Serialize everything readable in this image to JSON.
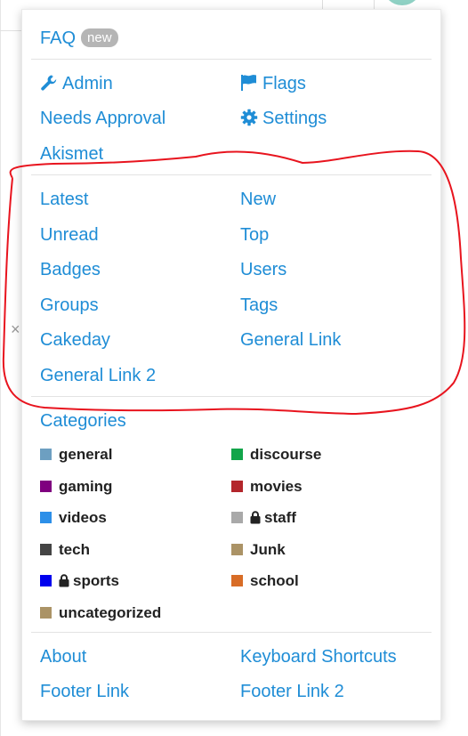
{
  "menu": {
    "faq_label": "FAQ",
    "faq_badge": "new",
    "admin": {
      "admin": "Admin",
      "flags": "Flags",
      "needs_approval": "Needs Approval",
      "settings": "Settings",
      "akismet": "Akismet"
    },
    "nav": {
      "latest": "Latest",
      "new": "New",
      "unread": "Unread",
      "top": "Top",
      "badges": "Badges",
      "users": "Users",
      "groups": "Groups",
      "tags": "Tags",
      "cakeday": "Cakeday",
      "general_link": "General Link",
      "general_link_2": "General Link 2"
    },
    "categories_label": "Categories",
    "categories": [
      {
        "name": "general",
        "color": "#6d9fc1",
        "locked": false
      },
      {
        "name": "discourse",
        "color": "#12a54a",
        "locked": false
      },
      {
        "name": "gaming",
        "color": "#7f007f",
        "locked": false
      },
      {
        "name": "movies",
        "color": "#b3262b",
        "locked": false
      },
      {
        "name": "videos",
        "color": "#2c8fe8",
        "locked": false
      },
      {
        "name": "staff",
        "color": "#a9a9a9",
        "locked": true
      },
      {
        "name": "tech",
        "color": "#444444",
        "locked": false
      },
      {
        "name": "Junk",
        "color": "#ab9366",
        "locked": false
      },
      {
        "name": "sports",
        "color": "#0000ee",
        "locked": true
      },
      {
        "name": "school",
        "color": "#d86c26",
        "locked": false
      },
      {
        "name": "uncategorized",
        "color": "#ab9366",
        "locked": false
      }
    ],
    "footer": {
      "about": "About",
      "keyboard_shortcuts": "Keyboard Shortcuts",
      "footer_link": "Footer Link",
      "footer_link_2": "Footer Link 2"
    }
  },
  "colors": {
    "link": "#1f8dd6",
    "annotation": "#e8141e",
    "badge_bg": "#b5b5b5"
  },
  "icons": {
    "admin": "wrench-icon",
    "flags": "flag-icon",
    "settings": "gear-icon",
    "locked_category": "lock-icon"
  }
}
